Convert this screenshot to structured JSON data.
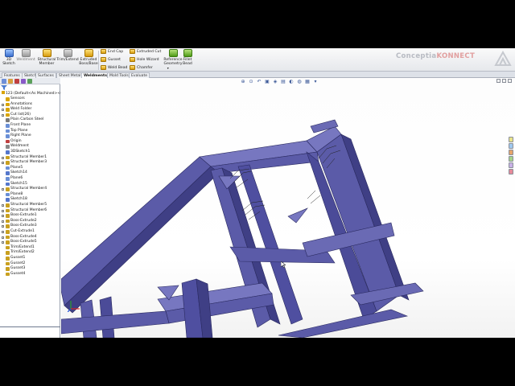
{
  "ribbon": {
    "buttons": [
      {
        "label": "3D\nSketch",
        "icon": "3d-sketch-icon"
      },
      {
        "label": "Weldment",
        "icon": "weldment-icon"
      },
      {
        "label": "Structural\nMember",
        "icon": "structural-member-icon"
      },
      {
        "label": "Trim/Extend",
        "icon": "trim-extend-icon"
      },
      {
        "label": "Extruded\nBoss/Base",
        "icon": "extruded-boss-icon"
      }
    ],
    "small_col1": [
      "End Cap",
      "Gusset",
      "Weld Bead"
    ],
    "small_col2": [
      "Extruded Cut",
      "Hole Wizard",
      "Chamfer"
    ],
    "buttons2": [
      {
        "label": "Reference\nGeometry",
        "icon": "reference-geometry-icon"
      },
      {
        "label": "Fillet\nBead",
        "icon": "fillet-bead-icon"
      }
    ]
  },
  "logo": {
    "text_a": "Conceptia",
    "text_b": "KONNECT"
  },
  "tabs": [
    {
      "label": "Features",
      "active": false
    },
    {
      "label": "Sketch",
      "active": false
    },
    {
      "label": "Surfaces",
      "active": false
    },
    {
      "label": "Sheet Metal",
      "active": false
    },
    {
      "label": "Weldments",
      "active": true
    },
    {
      "label": "Mold Tools",
      "active": false
    },
    {
      "label": "Evaluate",
      "active": false
    }
  ],
  "tree": {
    "root": "123 (Default<As Machined><<<D",
    "items": [
      {
        "label": "Sensors",
        "icon": "sensors-icon",
        "color": "#d9a400",
        "expand": false
      },
      {
        "label": "Annotations",
        "icon": "annotations-icon",
        "color": "#d9a400",
        "expand": true
      },
      {
        "label": "Weld Folder",
        "icon": "weld-folder-icon",
        "color": "#d9a400",
        "expand": true
      },
      {
        "label": "Cut list(26)",
        "icon": "cut-list-icon",
        "color": "#d9a400",
        "expand": true
      },
      {
        "label": "Plain Carbon Steel",
        "icon": "material-icon",
        "color": "#7a7a7a",
        "expand": false
      },
      {
        "label": "Front Plane",
        "icon": "plane-icon",
        "color": "#6a8fd6",
        "expand": false
      },
      {
        "label": "Top Plane",
        "icon": "plane-icon",
        "color": "#6a8fd6",
        "expand": false
      },
      {
        "label": "Right Plane",
        "icon": "plane-icon",
        "color": "#6a8fd6",
        "expand": false
      },
      {
        "label": "Origin",
        "icon": "origin-icon",
        "color": "#c04040",
        "expand": false
      },
      {
        "label": "Weldment",
        "icon": "weldment-icon",
        "color": "#888888",
        "expand": false
      },
      {
        "label": "3DSketch1",
        "icon": "sketch-icon",
        "color": "#5577cc",
        "expand": false
      },
      {
        "label": "Structural Member1",
        "icon": "structural-member-icon",
        "color": "#c9a020",
        "expand": true
      },
      {
        "label": "Structural Member3",
        "icon": "structural-member-icon",
        "color": "#c9a020",
        "expand": true
      },
      {
        "label": "Plane5",
        "icon": "plane-icon",
        "color": "#6a8fd6",
        "expand": false
      },
      {
        "label": "Sketch14",
        "icon": "sketch-icon",
        "color": "#5577cc",
        "expand": false
      },
      {
        "label": "Plane6",
        "icon": "plane-icon",
        "color": "#6a8fd6",
        "expand": false
      },
      {
        "label": "Sketch15",
        "icon": "sketch-icon",
        "color": "#5577cc",
        "expand": false
      },
      {
        "label": "Structural Member4",
        "icon": "structural-member-icon",
        "color": "#c9a020",
        "expand": true
      },
      {
        "label": "Plane8",
        "icon": "plane-icon",
        "color": "#6a8fd6",
        "expand": false
      },
      {
        "label": "Sketch18",
        "icon": "sketch-icon",
        "color": "#5577cc",
        "expand": false
      },
      {
        "label": "Structural Member5",
        "icon": "structural-member-icon",
        "color": "#c9a020",
        "expand": true
      },
      {
        "label": "Structural Member6",
        "icon": "structural-member-icon",
        "color": "#c9a020",
        "expand": true
      },
      {
        "label": "Boss-Extrude1",
        "icon": "boss-extrude-icon",
        "color": "#c9a020",
        "expand": true
      },
      {
        "label": "Boss-Extrude2",
        "icon": "boss-extrude-icon",
        "color": "#c9a020",
        "expand": true
      },
      {
        "label": "Boss-Extrude3",
        "icon": "boss-extrude-icon",
        "color": "#c9a020",
        "expand": true
      },
      {
        "label": "Cut-Extrude1",
        "icon": "cut-extrude-icon",
        "color": "#c9a020",
        "expand": true
      },
      {
        "label": "Boss-Extrude4",
        "icon": "boss-extrude-icon",
        "color": "#c9a020",
        "expand": true
      },
      {
        "label": "Boss-Extrude5",
        "icon": "boss-extrude-icon",
        "color": "#c9a020",
        "expand": true
      },
      {
        "label": "Trim/Extend1",
        "icon": "trim-extend-icon",
        "color": "#c9a020",
        "expand": false
      },
      {
        "label": "Trim/Extend2",
        "icon": "trim-extend-icon",
        "color": "#c9a020",
        "expand": false
      },
      {
        "label": "Gusset1",
        "icon": "gusset-icon",
        "color": "#c9a020",
        "expand": false
      },
      {
        "label": "Gusset2",
        "icon": "gusset-icon",
        "color": "#c9a020",
        "expand": false
      },
      {
        "label": "Gusset3",
        "icon": "gusset-icon",
        "color": "#c9a020",
        "expand": false
      },
      {
        "label": "Gusset4",
        "icon": "gusset-icon",
        "color": "#c9a020",
        "expand": false
      }
    ]
  },
  "viewport": {
    "frame_color": "#5b5ba8",
    "frame_dark": "#3f3f85",
    "frame_light": "#7777c0"
  }
}
